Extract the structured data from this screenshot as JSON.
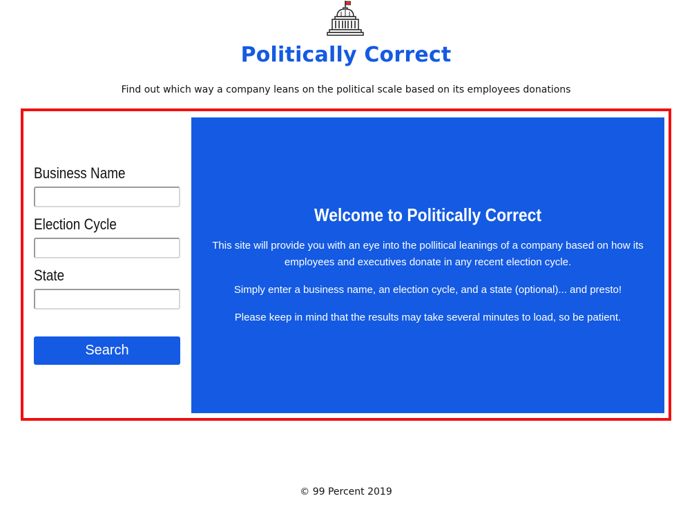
{
  "colors": {
    "accent": "#145ae2",
    "frame_border": "#f20f0f",
    "text": "#111111"
  },
  "header": {
    "logo_icon": "capitol-building-icon",
    "title": "Politically Correct",
    "tagline": "Find out which way a company leans on the political scale based on its employees donations"
  },
  "form": {
    "business_name_label": "Business Name",
    "business_name_value": "",
    "election_cycle_label": "Election Cycle",
    "election_cycle_value": "",
    "state_label": "State",
    "state_value": "",
    "search_button_label": "Search"
  },
  "welcome": {
    "title": "Welcome to Politically Correct",
    "paragraphs": [
      "This site will provide you with an eye into the pollitical leanings of a company based on how its employees and executives donate in any recent election cycle.",
      "Simply enter a business name, an election cycle, and a state (optional)... and presto!",
      "Please keep in mind that the results may take several minutes to load, so be patient."
    ]
  },
  "footer": {
    "text": "© 99 Percent 2019"
  }
}
